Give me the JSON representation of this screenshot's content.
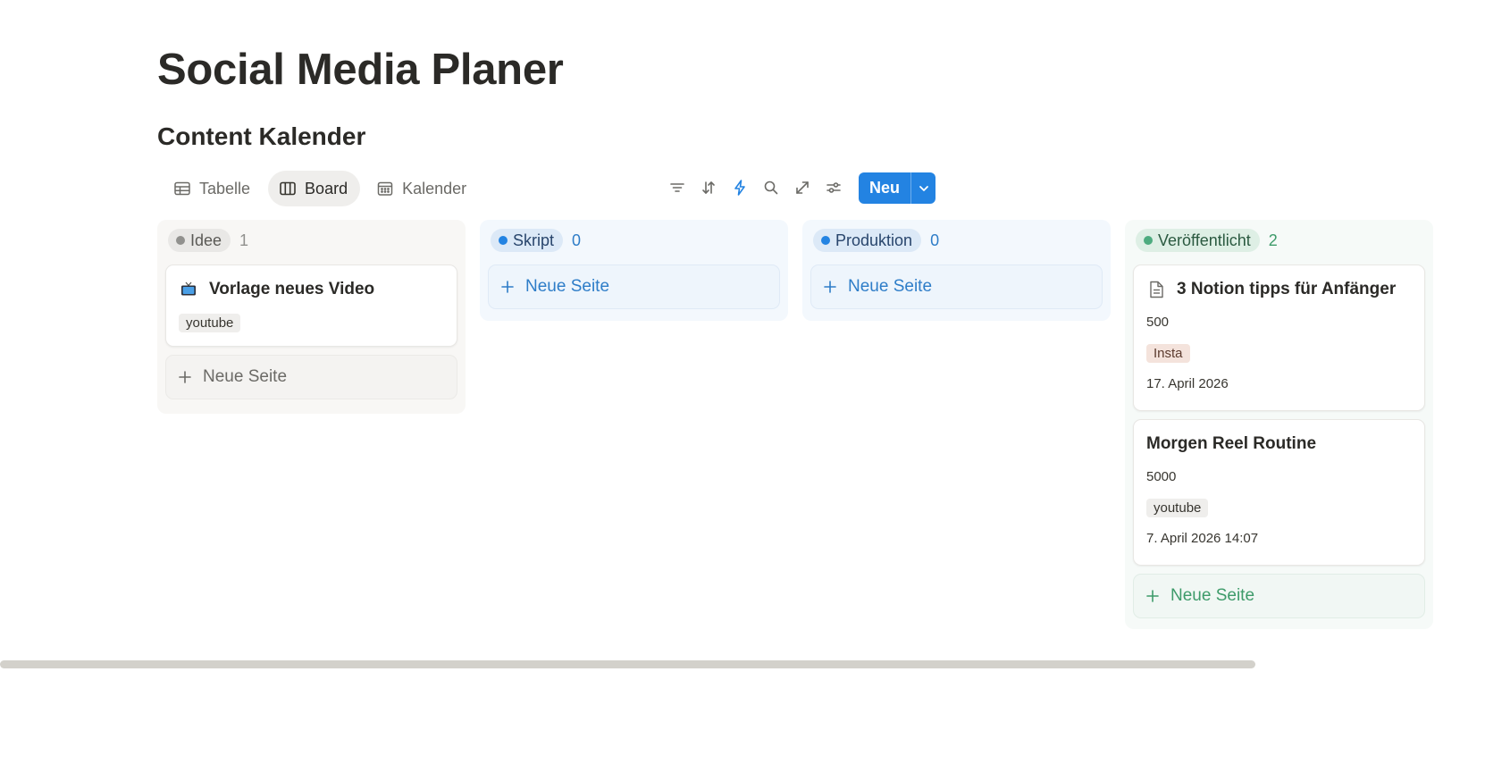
{
  "page": {
    "title": "Social Media Planer",
    "database_title": "Content Kalender"
  },
  "views": [
    {
      "label": "Tabelle",
      "icon": "table-icon",
      "active": false
    },
    {
      "label": "Board",
      "icon": "board-icon",
      "active": true
    },
    {
      "label": "Kalender",
      "icon": "calendar-icon",
      "active": false
    }
  ],
  "toolbar": {
    "icons": [
      "filter-icon",
      "sort-icon",
      "automation-lightning-icon",
      "search-icon",
      "expand-icon",
      "settings-sliders-icon"
    ],
    "new_label": "Neu"
  },
  "colors": {
    "accent": "#2383e2",
    "gray_dot": "#91918e",
    "blue_dot": "#2383e2",
    "green_dot": "#4dab7f"
  },
  "columns": [
    {
      "name": "Idee",
      "count": "1",
      "cards": [
        {
          "title": "Vorlage neues Video",
          "icon": "tv-icon",
          "tag": "youtube"
        }
      ],
      "new_label": "Neue Seite"
    },
    {
      "name": "Skript",
      "count": "0",
      "cards": [],
      "new_label": "Neue Seite"
    },
    {
      "name": "Produktion",
      "count": "0",
      "cards": [],
      "new_label": "Neue Seite"
    },
    {
      "name": "Veröffentlicht",
      "count": "2",
      "cards": [
        {
          "title": "3 Notion tipps für Anfänger",
          "icon": "document-icon",
          "number": "500",
          "tag": "Insta",
          "date": "17. April 2026"
        },
        {
          "title": "Morgen Reel Routine",
          "number": "5000",
          "tag": "youtube",
          "date": "7. April 2026 14:07"
        }
      ],
      "new_label": "Neue Seite"
    }
  ]
}
